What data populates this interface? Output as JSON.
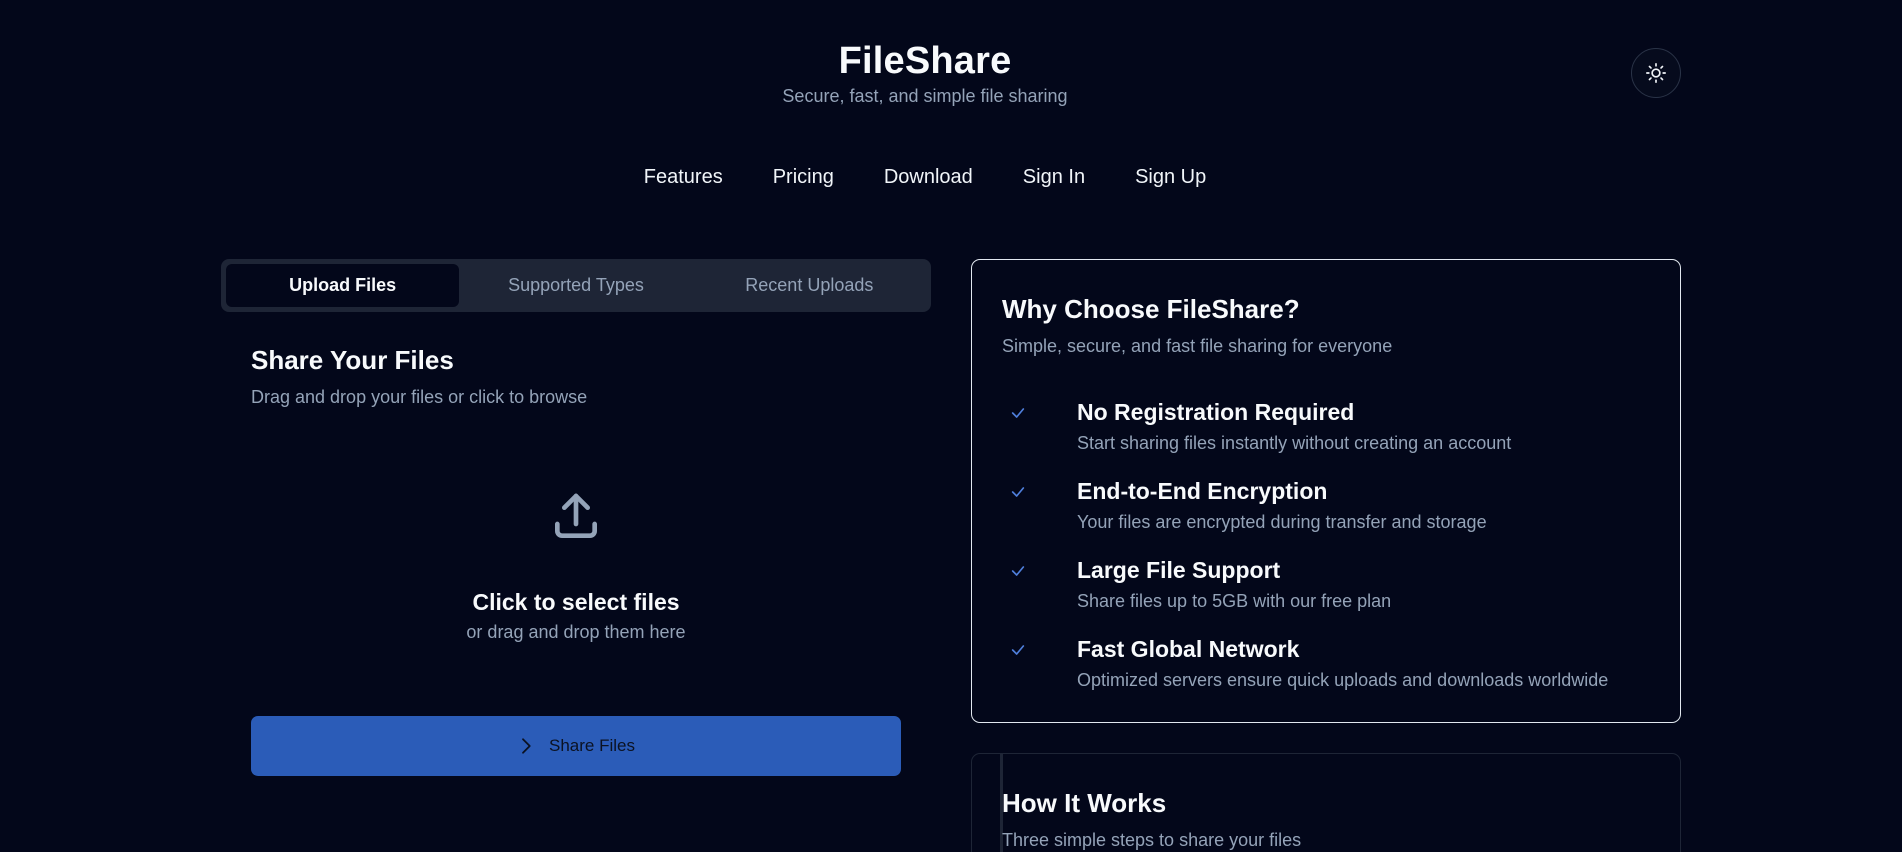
{
  "header": {
    "title": "FileShare",
    "subtitle": "Secure, fast, and simple file sharing",
    "theme_toggle_icon": "sun-icon"
  },
  "nav": {
    "items": [
      "Features",
      "Pricing",
      "Download",
      "Sign In",
      "Sign Up"
    ]
  },
  "tabs": {
    "items": [
      "Upload Files",
      "Supported Types",
      "Recent Uploads"
    ],
    "active": "Upload Files"
  },
  "upload": {
    "title": "Share Your Files",
    "description": "Drag and drop your files or click to browse",
    "drop_title": "Click to select files",
    "drop_subtitle": "or drag and drop them here",
    "drop_icon": "upload-icon",
    "button_label": "Share Files",
    "button_icon": "chevron-right-icon"
  },
  "why": {
    "title": "Why Choose FileShare?",
    "subtitle": "Simple, secure, and fast file sharing for everyone",
    "features": [
      {
        "title": "No Registration Required",
        "description": "Start sharing files instantly without creating an account"
      },
      {
        "title": "End-to-End Encryption",
        "description": "Your files are encrypted during transfer and storage"
      },
      {
        "title": "Large File Support",
        "description": "Share files up to 5GB with our free plan"
      },
      {
        "title": "Fast Global Network",
        "description": "Optimized servers ensure quick uploads and downloads worldwide"
      }
    ]
  },
  "how": {
    "title": "How It Works",
    "subtitle": "Three simple steps to share your files"
  },
  "colors": {
    "background": "#03071a",
    "primary_button": "#2b5cb8",
    "check_accent": "#4f7fdc",
    "muted_text": "#94a3b8"
  }
}
